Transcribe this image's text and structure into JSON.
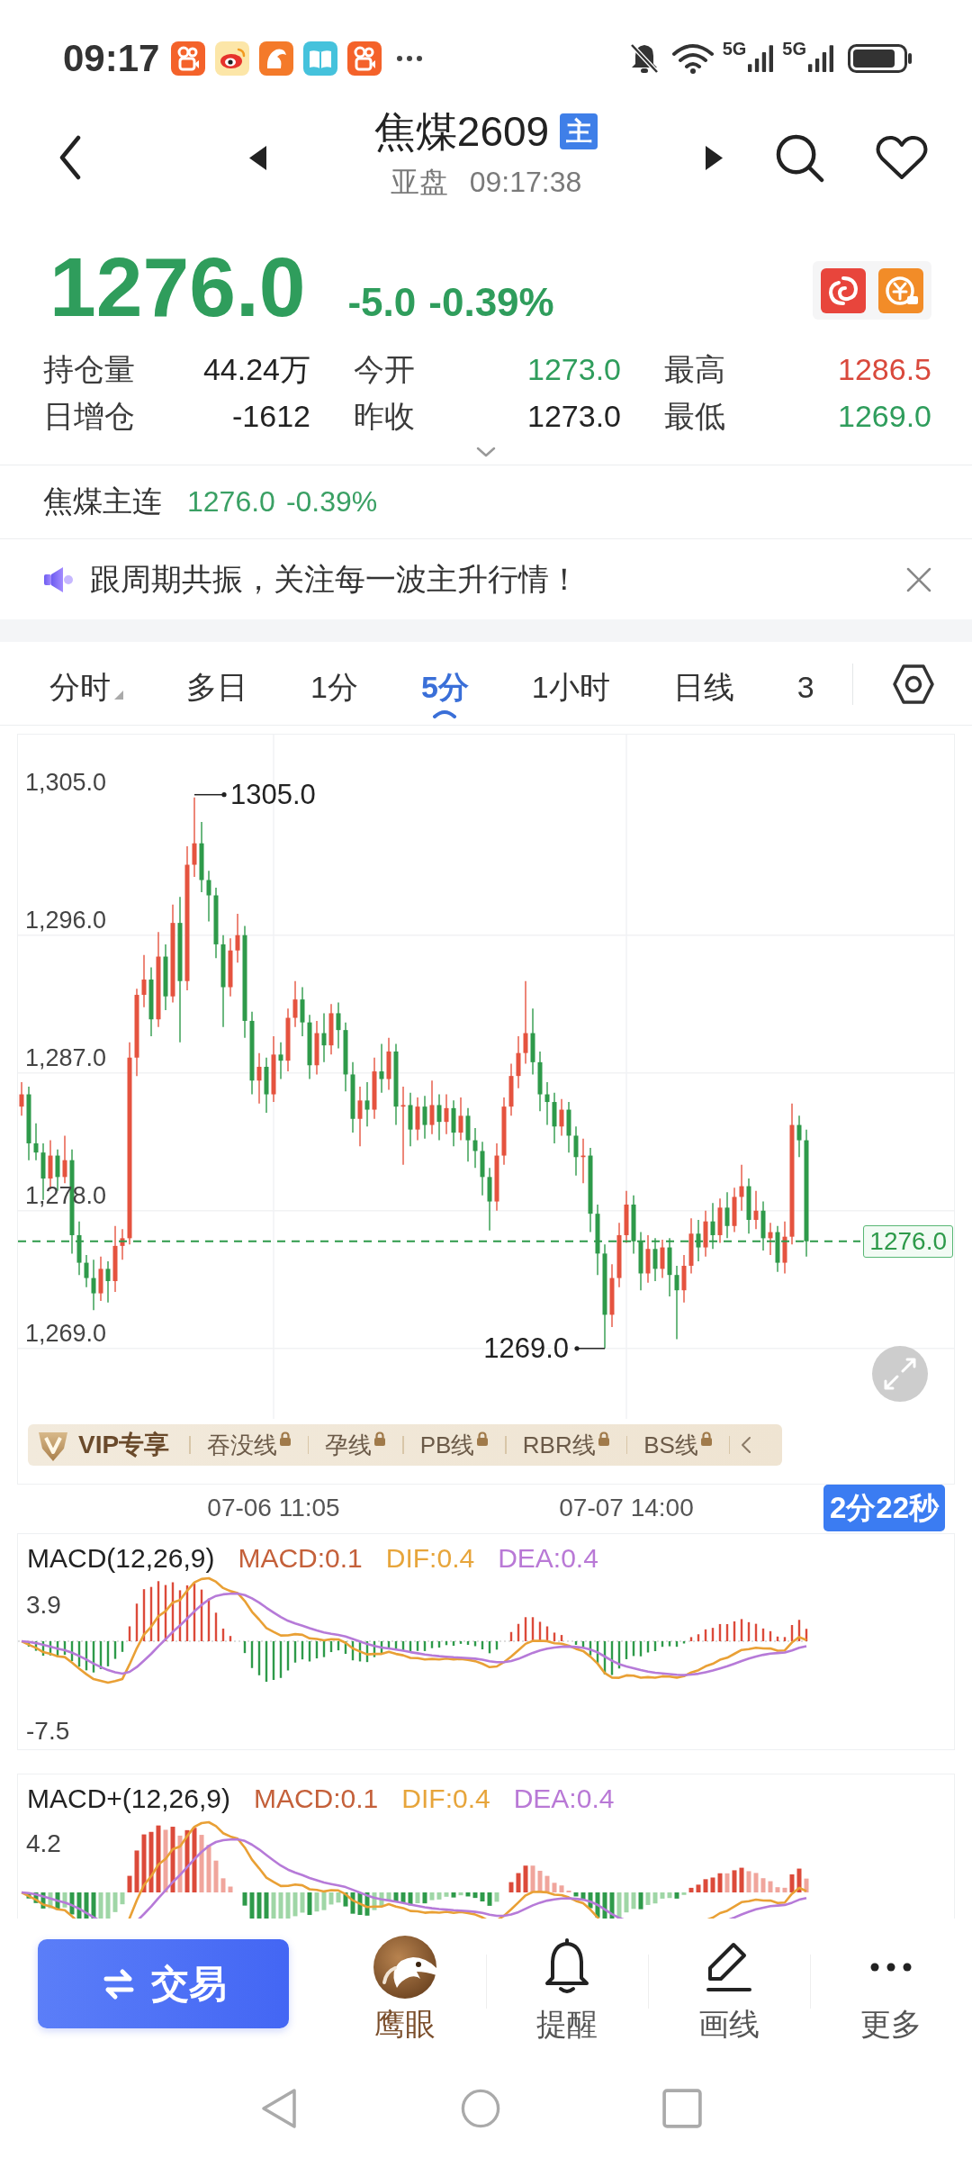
{
  "status_bar": {
    "time": "09:17",
    "networks": [
      "5G",
      "5G"
    ]
  },
  "header": {
    "title": "焦煤2609",
    "badge": "主",
    "session": "亚盘",
    "time": "09:17:38"
  },
  "quote": {
    "price": "1276.0",
    "change": "-5.0",
    "change_pct": "-0.39%"
  },
  "stats": [
    {
      "label": "持仓量",
      "value": "44.24万",
      "color": "#222222"
    },
    {
      "label": "今开",
      "value": "1273.0",
      "color": "#2f9d5c"
    },
    {
      "label": "最高",
      "value": "1286.5",
      "color": "#d9493c"
    },
    {
      "label": "日增仓",
      "value": "-1612",
      "color": "#222222"
    },
    {
      "label": "昨收",
      "value": "1273.0",
      "color": "#222222"
    },
    {
      "label": "最低",
      "value": "1269.0",
      "color": "#2f9d5c"
    }
  ],
  "main_contract": {
    "name": "焦煤主连",
    "price": "1276.0",
    "change_pct": "-0.39%"
  },
  "notice": {
    "text": "跟周期共振，关注每一波主升行情！"
  },
  "period_tabs": [
    {
      "label": "分时",
      "selected": false,
      "dropdown": true
    },
    {
      "label": "多日",
      "selected": false,
      "dropdown": false
    },
    {
      "label": "1分",
      "selected": false,
      "dropdown": false
    },
    {
      "label": "5分",
      "selected": true,
      "dropdown": false
    },
    {
      "label": "1小时",
      "selected": false,
      "dropdown": false
    },
    {
      "label": "日线",
      "selected": false,
      "dropdown": false
    },
    {
      "label": "3",
      "selected": false,
      "dropdown": false
    }
  ],
  "chart": {
    "chart_data": {
      "type": "candlestick",
      "categories": [
        null,
        null,
        null,
        null,
        null,
        null,
        null,
        null,
        null,
        null,
        null,
        null,
        null,
        null,
        null,
        null,
        null,
        null,
        null,
        null,
        null,
        null,
        null,
        null,
        null,
        null,
        null,
        null,
        null,
        null,
        null,
        null,
        null,
        null,
        null,
        "07-06 11:05",
        null,
        null,
        null,
        null,
        null,
        null,
        null,
        null,
        null,
        null,
        null,
        null,
        null,
        null,
        null,
        null,
        null,
        null,
        null,
        null,
        null,
        null,
        null,
        null,
        null,
        null,
        null,
        null,
        null,
        null,
        null,
        null,
        null,
        null,
        null,
        null,
        null,
        null,
        null,
        null,
        null,
        null,
        null,
        null,
        null,
        null,
        null,
        null,
        "07-07 14:00",
        null,
        null,
        null,
        null,
        null,
        null,
        null,
        null,
        null,
        null,
        null,
        null,
        null,
        null,
        null,
        null,
        null,
        null,
        null,
        null,
        null,
        null,
        null,
        null,
        null
      ],
      "ohlc": [
        [
          1284.8,
          1286.4,
          1284.2,
          1285.6
        ],
        [
          1285.6,
          1286.1,
          1281.3,
          1282.4
        ],
        [
          1282.4,
          1283.7,
          1281.3,
          1281.8
        ],
        [
          1281.8,
          1282.4,
          1278.7,
          1280.1
        ],
        [
          1280.1,
          1282.6,
          1279.4,
          1281.6
        ],
        [
          1281.6,
          1282.0,
          1279.3,
          1280.2
        ],
        [
          1280.2,
          1282.9,
          1279.8,
          1281.3
        ],
        [
          1281.3,
          1282.0,
          1275.2,
          1276.4
        ],
        [
          1276.4,
          1277.3,
          1273.8,
          1274.6
        ],
        [
          1274.6,
          1275.1,
          1273.0,
          1273.6
        ],
        [
          1273.6,
          1274.8,
          1271.5,
          1272.6
        ],
        [
          1272.6,
          1275.0,
          1272.1,
          1274.2
        ],
        [
          1274.2,
          1274.7,
          1272.0,
          1273.4
        ],
        [
          1273.4,
          1277.0,
          1272.7,
          1275.7
        ],
        [
          1275.7,
          1276.8,
          1274.8,
          1276.2
        ],
        [
          1276.2,
          1289.0,
          1275.8,
          1288.0
        ],
        [
          1288.0,
          1292.5,
          1286.8,
          1292.1
        ],
        [
          1292.1,
          1294.7,
          1291.3,
          1293.1
        ],
        [
          1293.1,
          1293.9,
          1289.4,
          1290.5
        ],
        [
          1290.5,
          1296.2,
          1290.0,
          1294.6
        ],
        [
          1294.6,
          1295.4,
          1291.1,
          1292.0
        ],
        [
          1292.0,
          1298.0,
          1291.6,
          1296.8
        ],
        [
          1296.8,
          1298.5,
          1289.0,
          1293.0
        ],
        [
          1293.0,
          1301.8,
          1292.4,
          1300.6
        ],
        [
          1300.6,
          1305.0,
          1299.8,
          1302.0
        ],
        [
          1302.0,
          1303.4,
          1298.8,
          1299.6
        ],
        [
          1299.6,
          1300.2,
          1296.9,
          1298.6
        ],
        [
          1298.6,
          1299.1,
          1294.5,
          1295.4
        ],
        [
          1295.4,
          1296.0,
          1290.0,
          1292.6
        ],
        [
          1292.6,
          1295.8,
          1292.0,
          1295.0
        ],
        [
          1295.0,
          1297.4,
          1294.2,
          1296.0
        ],
        [
          1296.0,
          1296.6,
          1289.3,
          1290.4
        ],
        [
          1290.4,
          1291.0,
          1285.6,
          1286.5
        ],
        [
          1286.5,
          1288.3,
          1285.0,
          1287.4
        ],
        [
          1287.4,
          1288.0,
          1284.4,
          1285.6
        ],
        [
          1285.6,
          1289.4,
          1285.1,
          1288.2
        ],
        [
          1288.2,
          1289.0,
          1286.6,
          1287.8
        ],
        [
          1287.8,
          1291.2,
          1287.1,
          1290.6
        ],
        [
          1290.6,
          1293.0,
          1290.0,
          1291.8
        ],
        [
          1291.8,
          1292.6,
          1289.4,
          1290.3
        ],
        [
          1290.3,
          1290.8,
          1286.6,
          1287.5
        ],
        [
          1287.5,
          1290.4,
          1286.9,
          1289.6
        ],
        [
          1289.6,
          1290.9,
          1287.7,
          1288.8
        ],
        [
          1288.8,
          1291.5,
          1288.2,
          1290.9
        ],
        [
          1290.9,
          1291.6,
          1288.6,
          1289.8
        ],
        [
          1289.8,
          1290.3,
          1285.8,
          1286.9
        ],
        [
          1286.9,
          1287.7,
          1283.1,
          1284.0
        ],
        [
          1284.0,
          1286.1,
          1282.2,
          1285.2
        ],
        [
          1285.2,
          1286.4,
          1283.5,
          1284.6
        ],
        [
          1284.6,
          1288.0,
          1284.0,
          1287.1
        ],
        [
          1287.1,
          1288.9,
          1285.7,
          1286.6
        ],
        [
          1286.6,
          1289.3,
          1285.9,
          1288.4
        ],
        [
          1288.4,
          1288.9,
          1283.6,
          1284.8
        ],
        [
          1284.8,
          1286.1,
          1281.0,
          1284.9
        ],
        [
          1284.9,
          1285.7,
          1282.2,
          1283.3
        ],
        [
          1283.3,
          1285.4,
          1282.6,
          1284.8
        ],
        [
          1284.8,
          1285.5,
          1282.7,
          1283.6
        ],
        [
          1283.6,
          1286.5,
          1283.0,
          1284.9
        ],
        [
          1284.9,
          1285.6,
          1282.6,
          1283.8
        ],
        [
          1283.8,
          1285.6,
          1283.0,
          1284.7
        ],
        [
          1284.7,
          1285.2,
          1282.2,
          1283.1
        ],
        [
          1283.1,
          1285.4,
          1282.6,
          1284.2
        ],
        [
          1284.2,
          1284.7,
          1281.2,
          1282.6
        ],
        [
          1282.6,
          1283.4,
          1280.8,
          1281.9
        ],
        [
          1281.9,
          1282.5,
          1279.0,
          1280.2
        ],
        [
          1280.2,
          1280.8,
          1276.7,
          1278.6
        ],
        [
          1278.6,
          1282.4,
          1278.0,
          1281.6
        ],
        [
          1281.6,
          1285.4,
          1281.0,
          1284.8
        ],
        [
          1284.8,
          1287.6,
          1284.2,
          1286.8
        ],
        [
          1286.8,
          1289.4,
          1286.0,
          1288.3
        ],
        [
          1288.3,
          1293.0,
          1287.6,
          1289.6
        ],
        [
          1289.6,
          1291.2,
          1286.9,
          1287.7
        ],
        [
          1287.7,
          1288.4,
          1284.5,
          1285.6
        ],
        [
          1285.6,
          1286.4,
          1283.6,
          1285.1
        ],
        [
          1285.1,
          1285.7,
          1282.4,
          1283.5
        ],
        [
          1283.5,
          1285.3,
          1282.9,
          1284.6
        ],
        [
          1284.6,
          1285.1,
          1281.8,
          1282.9
        ],
        [
          1282.9,
          1283.5,
          1280.3,
          1281.5
        ],
        [
          1281.5,
          1282.7,
          1279.8,
          1281.6
        ],
        [
          1281.6,
          1282.1,
          1276.6,
          1277.8
        ],
        [
          1277.8,
          1278.4,
          1273.8,
          1275.2
        ],
        [
          1275.2,
          1275.8,
          1269.0,
          1271.2
        ],
        [
          1271.2,
          1274.5,
          1270.4,
          1273.6
        ],
        [
          1273.6,
          1277.2,
          1273.0,
          1276.4
        ],
        [
          1276.4,
          1279.3,
          1275.9,
          1278.4
        ],
        [
          1278.4,
          1279.0,
          1275.2,
          1276.0
        ],
        [
          1276.0,
          1276.6,
          1272.8,
          1273.9
        ],
        [
          1273.9,
          1276.4,
          1273.3,
          1275.5
        ],
        [
          1275.5,
          1276.2,
          1273.4,
          1274.2
        ],
        [
          1274.2,
          1276.1,
          1273.6,
          1275.6
        ],
        [
          1275.6,
          1276.2,
          1272.4,
          1273.8
        ],
        [
          1273.8,
          1274.4,
          1269.6,
          1272.8
        ],
        [
          1272.8,
          1275.1,
          1272.0,
          1274.4
        ],
        [
          1274.4,
          1277.5,
          1273.9,
          1276.5
        ],
        [
          1276.5,
          1277.4,
          1274.7,
          1275.6
        ],
        [
          1275.6,
          1278.0,
          1275.0,
          1277.3
        ],
        [
          1277.3,
          1278.5,
          1275.5,
          1276.4
        ],
        [
          1276.4,
          1278.8,
          1275.9,
          1278.2
        ],
        [
          1278.2,
          1279.2,
          1276.2,
          1277.0
        ],
        [
          1277.0,
          1279.5,
          1276.6,
          1278.9
        ],
        [
          1278.9,
          1281.0,
          1278.0,
          1279.6
        ],
        [
          1279.6,
          1280.1,
          1276.5,
          1277.4
        ],
        [
          1277.4,
          1279.3,
          1276.8,
          1278.0
        ],
        [
          1278.0,
          1278.6,
          1275.4,
          1276.2
        ],
        [
          1276.2,
          1277.2,
          1275.1,
          1276.6
        ],
        [
          1276.6,
          1277.0,
          1274.0,
          1274.6
        ],
        [
          1274.6,
          1277.3,
          1273.9,
          1276.3
        ],
        [
          1276.3,
          1285.0,
          1275.8,
          1283.6
        ],
        [
          1283.6,
          1284.2,
          1281.5,
          1282.6
        ],
        [
          1282.6,
          1283.3,
          1275.0,
          1276.0
        ]
      ],
      "ylim": [
        1264.4,
        1309.1
      ],
      "yticks": [
        {
          "value": 1305,
          "label": "1,305.0"
        },
        {
          "value": 1296,
          "label": "1,296.0"
        },
        {
          "value": 1287,
          "label": "1,287.0"
        },
        {
          "value": 1278,
          "label": "1,278.0"
        },
        {
          "value": 1269,
          "label": "1,269.0"
        }
      ],
      "grid": true,
      "annotations": [
        "1305.0",
        "1269.0"
      ],
      "ref_lines": [
        {
          "axis": "y",
          "value": 1276,
          "label": "1276.0"
        }
      ]
    },
    "countdown": "2分22秒"
  },
  "vip_bar": {
    "title": "VIP专享",
    "items": [
      {
        "label": "吞没线",
        "locked": true
      },
      {
        "label": "孕线",
        "locked": true
      },
      {
        "label": "PB线",
        "locked": true
      },
      {
        "label": "RBR线",
        "locked": true
      },
      {
        "label": "BS线",
        "locked": true
      }
    ]
  },
  "indicators": [
    {
      "kind": "macd",
      "name": "MACD(12,26,9)",
      "macd": "MACD:0.1",
      "dif": "DIF:0.4",
      "dea": "DEA:0.4",
      "upper": "3.9",
      "lower": "-7.5"
    },
    {
      "kind": "macd_plus",
      "name": "MACD+(12,26,9)",
      "macd": "MACD:0.1",
      "dif": "DIF:0.4",
      "dea": "DEA:0.4",
      "upper": "4.2"
    }
  ],
  "bottom_bar": {
    "trade": "交易",
    "items": [
      {
        "kind": "eagle",
        "label": "鹰眼"
      },
      {
        "kind": "bell",
        "label": "提醒"
      },
      {
        "kind": "pen",
        "label": "画线"
      },
      {
        "kind": "more",
        "label": "更多"
      }
    ]
  }
}
